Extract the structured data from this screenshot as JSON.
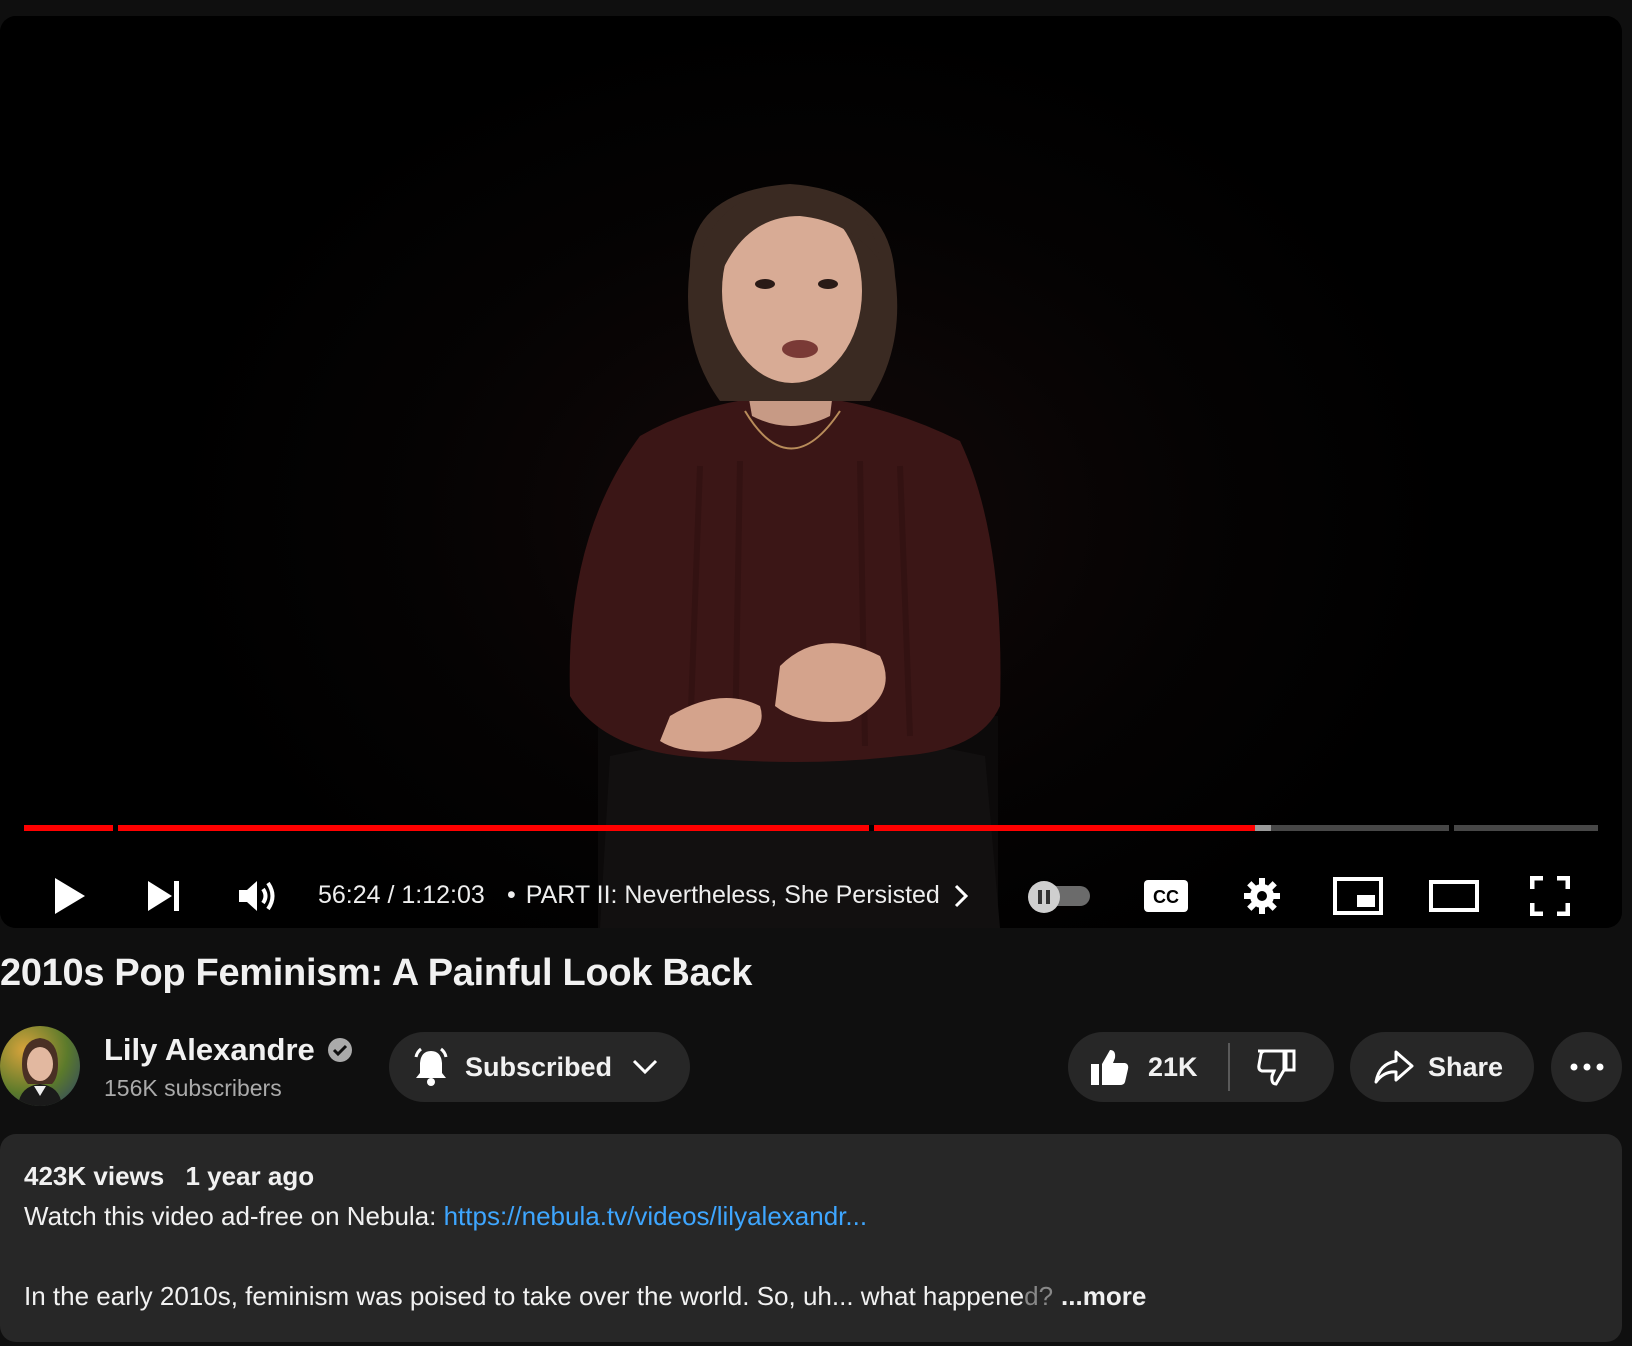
{
  "player": {
    "current_time": "56:24",
    "duration": "1:12:03",
    "time_display": "56:24 / 1:12:03",
    "chapter_separator": "•",
    "chapter_title": "PART II: Nevertheless, She Persisted",
    "progress_fraction": 0.782,
    "buffered_fraction": 0.792,
    "autoplay_on": false,
    "icons": {
      "play": "play-icon",
      "next": "next-icon",
      "volume": "volume-icon",
      "chapter_arrow": "chevron-right-icon",
      "autoplay": "autoplay-toggle-icon",
      "captions": "cc-icon",
      "settings": "gear-icon",
      "miniplayer": "miniplayer-icon",
      "theater": "theater-mode-icon",
      "fullscreen": "fullscreen-icon"
    },
    "captions_label": "CC"
  },
  "video": {
    "title": "2010s Pop Feminism: A Painful Look Back"
  },
  "channel": {
    "name": "Lily Alexandre",
    "subscribers": "156K subscribers",
    "verified": true
  },
  "actions": {
    "subscribe_label": "Subscribed",
    "like_count": "21K",
    "share_label": "Share"
  },
  "description": {
    "views": "423K views",
    "age": "1 year ago",
    "line1_prefix": "Watch this video ad-free on Nebula: ",
    "line1_link": "https://nebula.tv/videos/lilyalexandr...",
    "line2_text": "In the early 2010s, feminism was poised to take over the world. So, uh... what happene",
    "line2_fade": "d?",
    "more_label": "...more"
  },
  "colors": {
    "background": "#0f0f0f",
    "progress_played": "#ff0000",
    "link": "#3ea6ff",
    "pill": "#272727"
  }
}
